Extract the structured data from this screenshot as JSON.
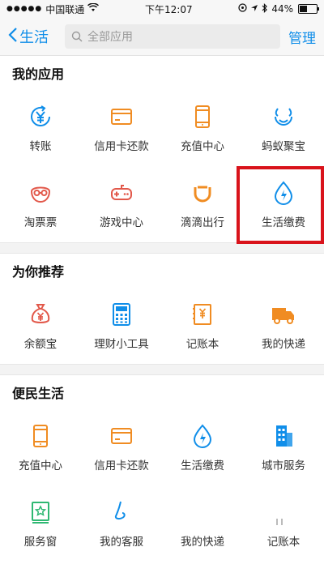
{
  "status": {
    "carrier": "中国联通",
    "time": "下午12:07",
    "battery": "44%"
  },
  "nav": {
    "back_label": "生活",
    "search_placeholder": "全部应用",
    "manage_label": "管理"
  },
  "sections": {
    "my_apps": {
      "title": "我的应用",
      "items": [
        {
          "label": "转账",
          "icon": "transfer-icon"
        },
        {
          "label": "信用卡还款",
          "icon": "credit-card-icon"
        },
        {
          "label": "充值中心",
          "icon": "phone-recharge-icon"
        },
        {
          "label": "蚂蚁聚宝",
          "icon": "ant-fortune-icon"
        },
        {
          "label": "淘票票",
          "icon": "movie-ticket-icon"
        },
        {
          "label": "游戏中心",
          "icon": "gamepad-icon"
        },
        {
          "label": "滴滴出行",
          "icon": "didi-icon"
        },
        {
          "label": "生活缴费",
          "icon": "utility-payment-icon"
        }
      ]
    },
    "recommend": {
      "title": "为你推荐",
      "items": [
        {
          "label": "余额宝",
          "icon": "money-bag-icon"
        },
        {
          "label": "理财小工具",
          "icon": "calculator-icon"
        },
        {
          "label": "记账本",
          "icon": "ledger-icon"
        },
        {
          "label": "我的快递",
          "icon": "delivery-truck-icon"
        }
      ]
    },
    "convenience": {
      "title": "便民生活",
      "items": [
        {
          "label": "充值中心",
          "icon": "phone-recharge-icon"
        },
        {
          "label": "信用卡还款",
          "icon": "credit-card-icon"
        },
        {
          "label": "生活缴费",
          "icon": "utility-payment-icon"
        },
        {
          "label": "城市服务",
          "icon": "city-building-icon"
        },
        {
          "label": "服务窗",
          "icon": "service-window-icon"
        },
        {
          "label": "我的客服",
          "icon": "customer-service-icon"
        },
        {
          "label": "我的快递",
          "icon": "delivery-truck-icon"
        },
        {
          "label": "记账本",
          "icon": "ledger-icon"
        }
      ]
    }
  },
  "colors": {
    "accent": "#108ee9",
    "orange": "#f08c22",
    "highlight": "#d9131b",
    "green": "#2eb872"
  }
}
